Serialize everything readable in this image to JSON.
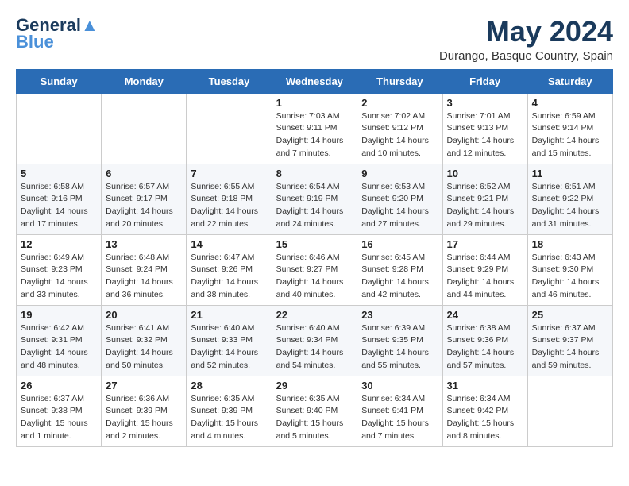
{
  "logo": {
    "line1": "General",
    "line2": "Blue"
  },
  "title": "May 2024",
  "location": "Durango, Basque Country, Spain",
  "weekdays": [
    "Sunday",
    "Monday",
    "Tuesday",
    "Wednesday",
    "Thursday",
    "Friday",
    "Saturday"
  ],
  "weeks": [
    [
      {
        "day": "",
        "sunrise": "",
        "sunset": "",
        "daylight": ""
      },
      {
        "day": "",
        "sunrise": "",
        "sunset": "",
        "daylight": ""
      },
      {
        "day": "",
        "sunrise": "",
        "sunset": "",
        "daylight": ""
      },
      {
        "day": "1",
        "sunrise": "Sunrise: 7:03 AM",
        "sunset": "Sunset: 9:11 PM",
        "daylight": "Daylight: 14 hours and 7 minutes."
      },
      {
        "day": "2",
        "sunrise": "Sunrise: 7:02 AM",
        "sunset": "Sunset: 9:12 PM",
        "daylight": "Daylight: 14 hours and 10 minutes."
      },
      {
        "day": "3",
        "sunrise": "Sunrise: 7:01 AM",
        "sunset": "Sunset: 9:13 PM",
        "daylight": "Daylight: 14 hours and 12 minutes."
      },
      {
        "day": "4",
        "sunrise": "Sunrise: 6:59 AM",
        "sunset": "Sunset: 9:14 PM",
        "daylight": "Daylight: 14 hours and 15 minutes."
      }
    ],
    [
      {
        "day": "5",
        "sunrise": "Sunrise: 6:58 AM",
        "sunset": "Sunset: 9:16 PM",
        "daylight": "Daylight: 14 hours and 17 minutes."
      },
      {
        "day": "6",
        "sunrise": "Sunrise: 6:57 AM",
        "sunset": "Sunset: 9:17 PM",
        "daylight": "Daylight: 14 hours and 20 minutes."
      },
      {
        "day": "7",
        "sunrise": "Sunrise: 6:55 AM",
        "sunset": "Sunset: 9:18 PM",
        "daylight": "Daylight: 14 hours and 22 minutes."
      },
      {
        "day": "8",
        "sunrise": "Sunrise: 6:54 AM",
        "sunset": "Sunset: 9:19 PM",
        "daylight": "Daylight: 14 hours and 24 minutes."
      },
      {
        "day": "9",
        "sunrise": "Sunrise: 6:53 AM",
        "sunset": "Sunset: 9:20 PM",
        "daylight": "Daylight: 14 hours and 27 minutes."
      },
      {
        "day": "10",
        "sunrise": "Sunrise: 6:52 AM",
        "sunset": "Sunset: 9:21 PM",
        "daylight": "Daylight: 14 hours and 29 minutes."
      },
      {
        "day": "11",
        "sunrise": "Sunrise: 6:51 AM",
        "sunset": "Sunset: 9:22 PM",
        "daylight": "Daylight: 14 hours and 31 minutes."
      }
    ],
    [
      {
        "day": "12",
        "sunrise": "Sunrise: 6:49 AM",
        "sunset": "Sunset: 9:23 PM",
        "daylight": "Daylight: 14 hours and 33 minutes."
      },
      {
        "day": "13",
        "sunrise": "Sunrise: 6:48 AM",
        "sunset": "Sunset: 9:24 PM",
        "daylight": "Daylight: 14 hours and 36 minutes."
      },
      {
        "day": "14",
        "sunrise": "Sunrise: 6:47 AM",
        "sunset": "Sunset: 9:26 PM",
        "daylight": "Daylight: 14 hours and 38 minutes."
      },
      {
        "day": "15",
        "sunrise": "Sunrise: 6:46 AM",
        "sunset": "Sunset: 9:27 PM",
        "daylight": "Daylight: 14 hours and 40 minutes."
      },
      {
        "day": "16",
        "sunrise": "Sunrise: 6:45 AM",
        "sunset": "Sunset: 9:28 PM",
        "daylight": "Daylight: 14 hours and 42 minutes."
      },
      {
        "day": "17",
        "sunrise": "Sunrise: 6:44 AM",
        "sunset": "Sunset: 9:29 PM",
        "daylight": "Daylight: 14 hours and 44 minutes."
      },
      {
        "day": "18",
        "sunrise": "Sunrise: 6:43 AM",
        "sunset": "Sunset: 9:30 PM",
        "daylight": "Daylight: 14 hours and 46 minutes."
      }
    ],
    [
      {
        "day": "19",
        "sunrise": "Sunrise: 6:42 AM",
        "sunset": "Sunset: 9:31 PM",
        "daylight": "Daylight: 14 hours and 48 minutes."
      },
      {
        "day": "20",
        "sunrise": "Sunrise: 6:41 AM",
        "sunset": "Sunset: 9:32 PM",
        "daylight": "Daylight: 14 hours and 50 minutes."
      },
      {
        "day": "21",
        "sunrise": "Sunrise: 6:40 AM",
        "sunset": "Sunset: 9:33 PM",
        "daylight": "Daylight: 14 hours and 52 minutes."
      },
      {
        "day": "22",
        "sunrise": "Sunrise: 6:40 AM",
        "sunset": "Sunset: 9:34 PM",
        "daylight": "Daylight: 14 hours and 54 minutes."
      },
      {
        "day": "23",
        "sunrise": "Sunrise: 6:39 AM",
        "sunset": "Sunset: 9:35 PM",
        "daylight": "Daylight: 14 hours and 55 minutes."
      },
      {
        "day": "24",
        "sunrise": "Sunrise: 6:38 AM",
        "sunset": "Sunset: 9:36 PM",
        "daylight": "Daylight: 14 hours and 57 minutes."
      },
      {
        "day": "25",
        "sunrise": "Sunrise: 6:37 AM",
        "sunset": "Sunset: 9:37 PM",
        "daylight": "Daylight: 14 hours and 59 minutes."
      }
    ],
    [
      {
        "day": "26",
        "sunrise": "Sunrise: 6:37 AM",
        "sunset": "Sunset: 9:38 PM",
        "daylight": "Daylight: 15 hours and 1 minute."
      },
      {
        "day": "27",
        "sunrise": "Sunrise: 6:36 AM",
        "sunset": "Sunset: 9:39 PM",
        "daylight": "Daylight: 15 hours and 2 minutes."
      },
      {
        "day": "28",
        "sunrise": "Sunrise: 6:35 AM",
        "sunset": "Sunset: 9:39 PM",
        "daylight": "Daylight: 15 hours and 4 minutes."
      },
      {
        "day": "29",
        "sunrise": "Sunrise: 6:35 AM",
        "sunset": "Sunset: 9:40 PM",
        "daylight": "Daylight: 15 hours and 5 minutes."
      },
      {
        "day": "30",
        "sunrise": "Sunrise: 6:34 AM",
        "sunset": "Sunset: 9:41 PM",
        "daylight": "Daylight: 15 hours and 7 minutes."
      },
      {
        "day": "31",
        "sunrise": "Sunrise: 6:34 AM",
        "sunset": "Sunset: 9:42 PM",
        "daylight": "Daylight: 15 hours and 8 minutes."
      },
      {
        "day": "",
        "sunrise": "",
        "sunset": "",
        "daylight": ""
      }
    ]
  ]
}
